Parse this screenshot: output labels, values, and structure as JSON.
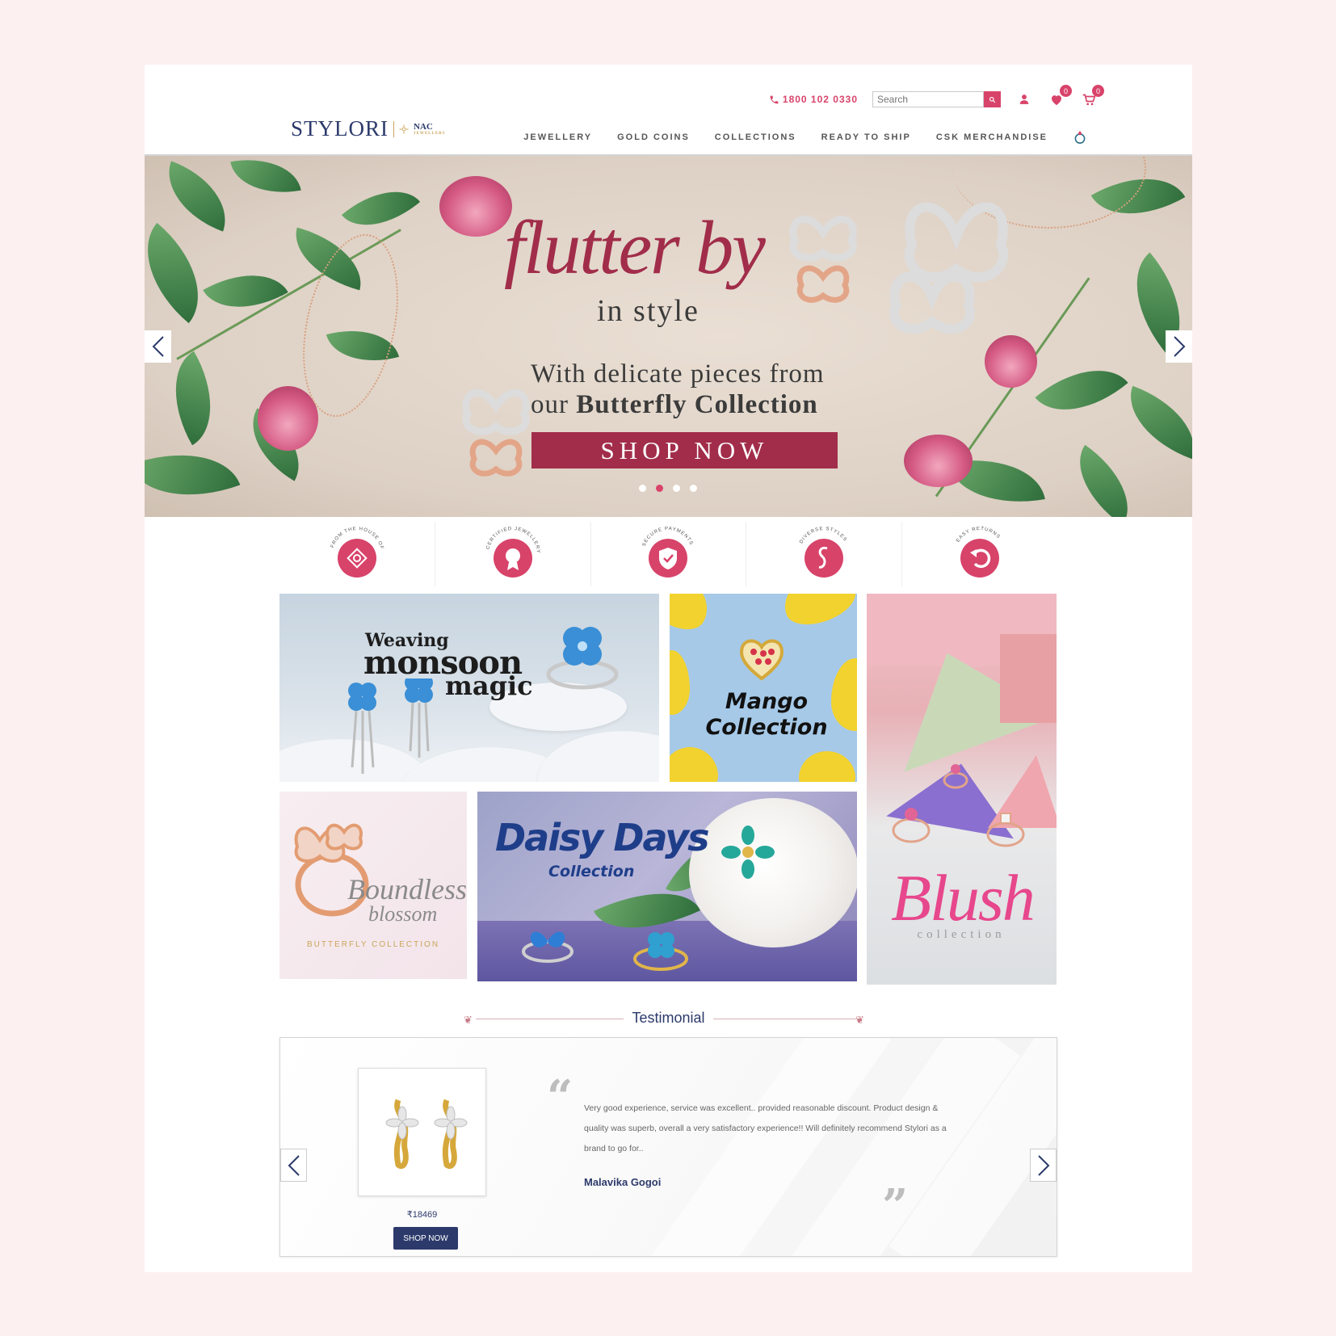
{
  "header": {
    "phone": "1800 102 0330",
    "search_placeholder": "Search",
    "wishlist_count": "0",
    "cart_count": "0",
    "logo_main": "STYLORI",
    "logo_partner": "NAC",
    "logo_partner_sub": "JEWELLERS"
  },
  "nav": {
    "items": [
      "JEWELLERY",
      "GOLD COINS",
      "COLLECTIONS",
      "READY TO SHIP",
      "CSK MERCHANDISE"
    ]
  },
  "hero": {
    "title": "flutter by",
    "subtitle": "in style",
    "line1": "With delicate pieces from",
    "line2_prefix": "our ",
    "line2_bold": "Butterfly Collection",
    "button": "SHOP NOW",
    "active_slide": 2,
    "slide_count": 4
  },
  "features": [
    {
      "label": "FROM THE HOUSE OF NAC",
      "icon": "nac-icon"
    },
    {
      "label": "CERTIFIED JEWELLERY",
      "icon": "certificate-icon"
    },
    {
      "label": "SECURE PAYMENTS",
      "icon": "shield-icon"
    },
    {
      "label": "DIVERSE STYLES",
      "icon": "styles-icon"
    },
    {
      "label": "EASY RETURNS",
      "icon": "return-icon"
    }
  ],
  "promos": {
    "monsoon": {
      "line1": "Weaving",
      "line2": "monsoon",
      "line3": "magic"
    },
    "mango": {
      "line1": "Mango",
      "line2": "Collection"
    },
    "blush": {
      "title": "Blush",
      "sub": "collection"
    },
    "boundless": {
      "line1": "Boundless",
      "line2": "blossom",
      "sub": "BUTTERFLY COLLECTION"
    },
    "daisy": {
      "title": "Daisy Days",
      "sub": "Collection"
    }
  },
  "testimonial": {
    "heading": "Testimonial",
    "price": "₹18469",
    "button": "SHOP NOW",
    "text": "Very good experience, service was excellent.. provided reasonable discount. Product design & quality was superb, overall a very satisfactory experience!! Will definitely recommend Stylori as a brand to go for..",
    "author": "Malavika Gogoi"
  },
  "colors": {
    "accent": "#d8436a",
    "brand_navy": "#2c3a6b",
    "hero_wine": "#a12d4a",
    "page_bg": "#fcf0f0"
  }
}
